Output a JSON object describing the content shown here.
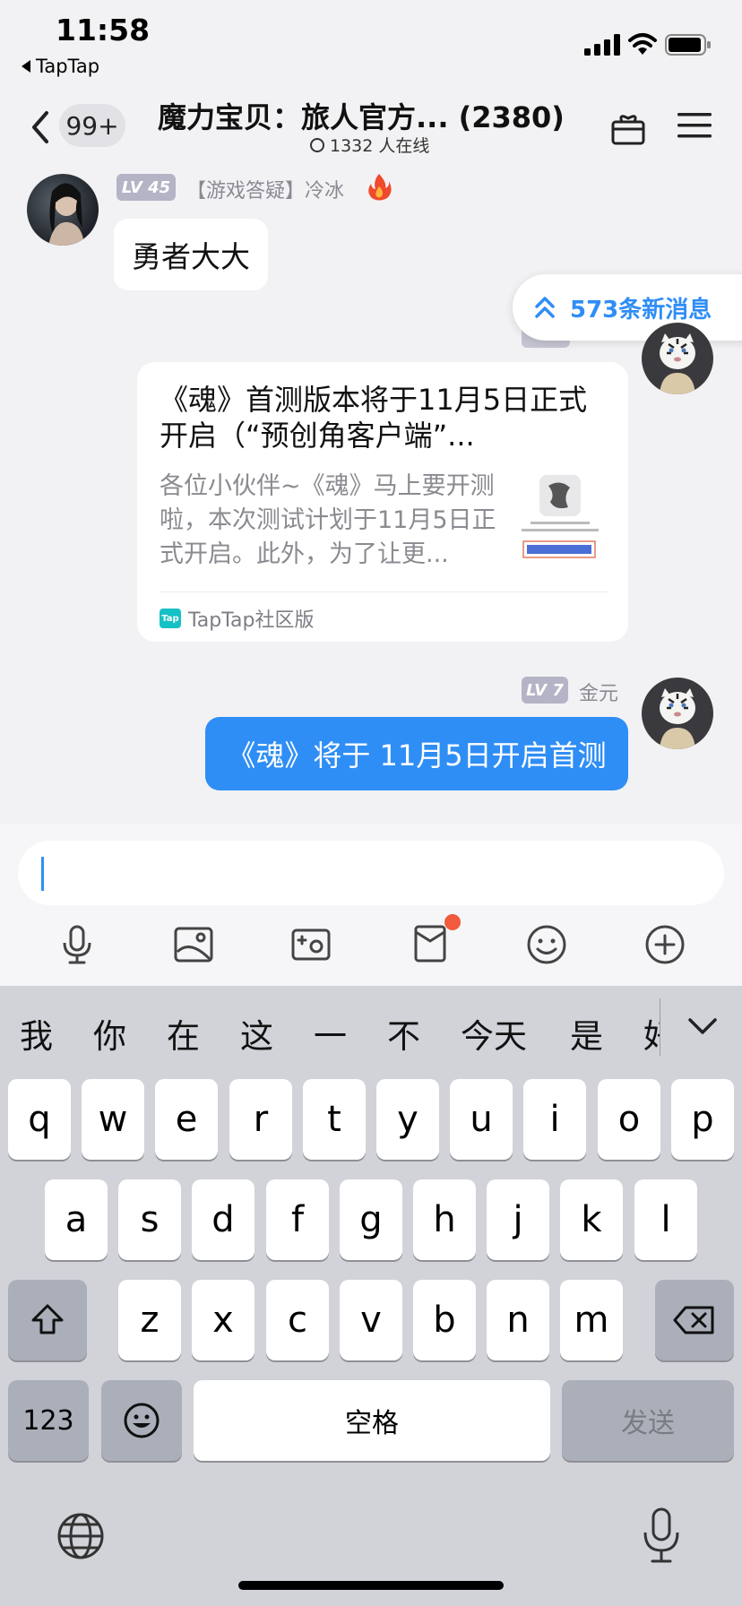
{
  "status_bar": {
    "time": "11:58",
    "back_app": "TapTap"
  },
  "nav": {
    "unread_count": "99+",
    "title": "魔力宝贝：旅人官方... (2380)",
    "online": "1332 人在线"
  },
  "messages": [
    {
      "level": "LV 45",
      "sender": "【游戏答疑】冷冰",
      "text": "勇者大大"
    },
    {
      "card_title": "《魂》首测版本将于11月5日正式开启（“预创角客户端”...",
      "card_desc": "各位小伙伴~《魂》马上要开测啦，本次测试计划于11月5日正式开启。此外，为了让更...",
      "source_logo": "Tap",
      "source": "TapTap社区版"
    },
    {
      "level": "LV 7",
      "sender": "金元",
      "text": "《魂》将于 11月5日开启首测"
    }
  ],
  "new_messages": "573条新消息",
  "input": {
    "value": ""
  },
  "toolbar": [
    "mic-icon",
    "image-icon",
    "photo-icon",
    "red-packet-icon",
    "emoji-icon",
    "plus-icon"
  ],
  "keyboard": {
    "candidates": [
      "我",
      "你",
      "在",
      "这",
      "一",
      "不",
      "今天",
      "是",
      "好"
    ],
    "row1": [
      "q",
      "w",
      "e",
      "r",
      "t",
      "y",
      "u",
      "i",
      "o",
      "p"
    ],
    "row2": [
      "a",
      "s",
      "d",
      "f",
      "g",
      "h",
      "j",
      "k",
      "l"
    ],
    "row3": [
      "z",
      "x",
      "c",
      "v",
      "b",
      "n",
      "m"
    ],
    "numbers_label": "123",
    "space_label": "空格",
    "send_label": "发送"
  },
  "colors": {
    "accent": "#2f8ef5",
    "keyboard_bg": "#d1d3d9",
    "badge_dot": "#f25a3c"
  }
}
